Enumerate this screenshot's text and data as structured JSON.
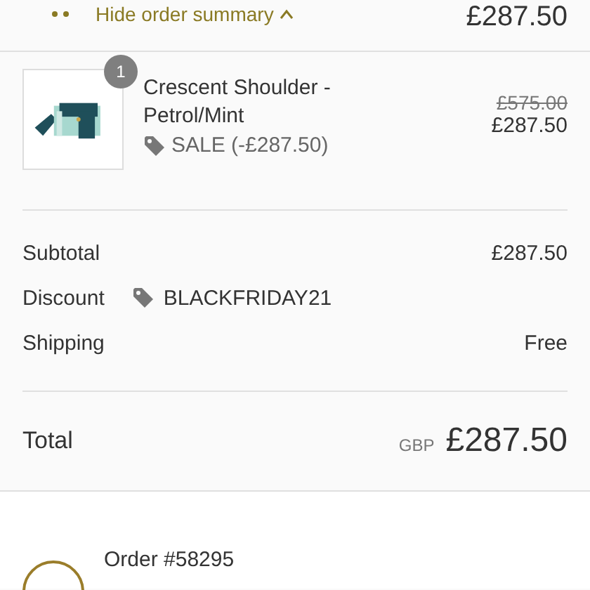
{
  "summary_toggle": {
    "label": "Hide order summary",
    "total": "£287.50"
  },
  "items": [
    {
      "quantity": "1",
      "name": "Crescent Shoulder - Petrol/Mint",
      "discount": "SALE (-£287.50)",
      "original_price": "£575.00",
      "price": "£287.50"
    }
  ],
  "costs": [
    {
      "label": "Subtotal",
      "value": "£287.50"
    },
    {
      "label": "Discount",
      "code": "BLACKFRIDAY21"
    },
    {
      "label": "Shipping",
      "value": "Free"
    }
  ],
  "total": {
    "label": "Total",
    "currency": "GBP",
    "value": "£287.50"
  },
  "order": {
    "number": "Order #58295"
  }
}
